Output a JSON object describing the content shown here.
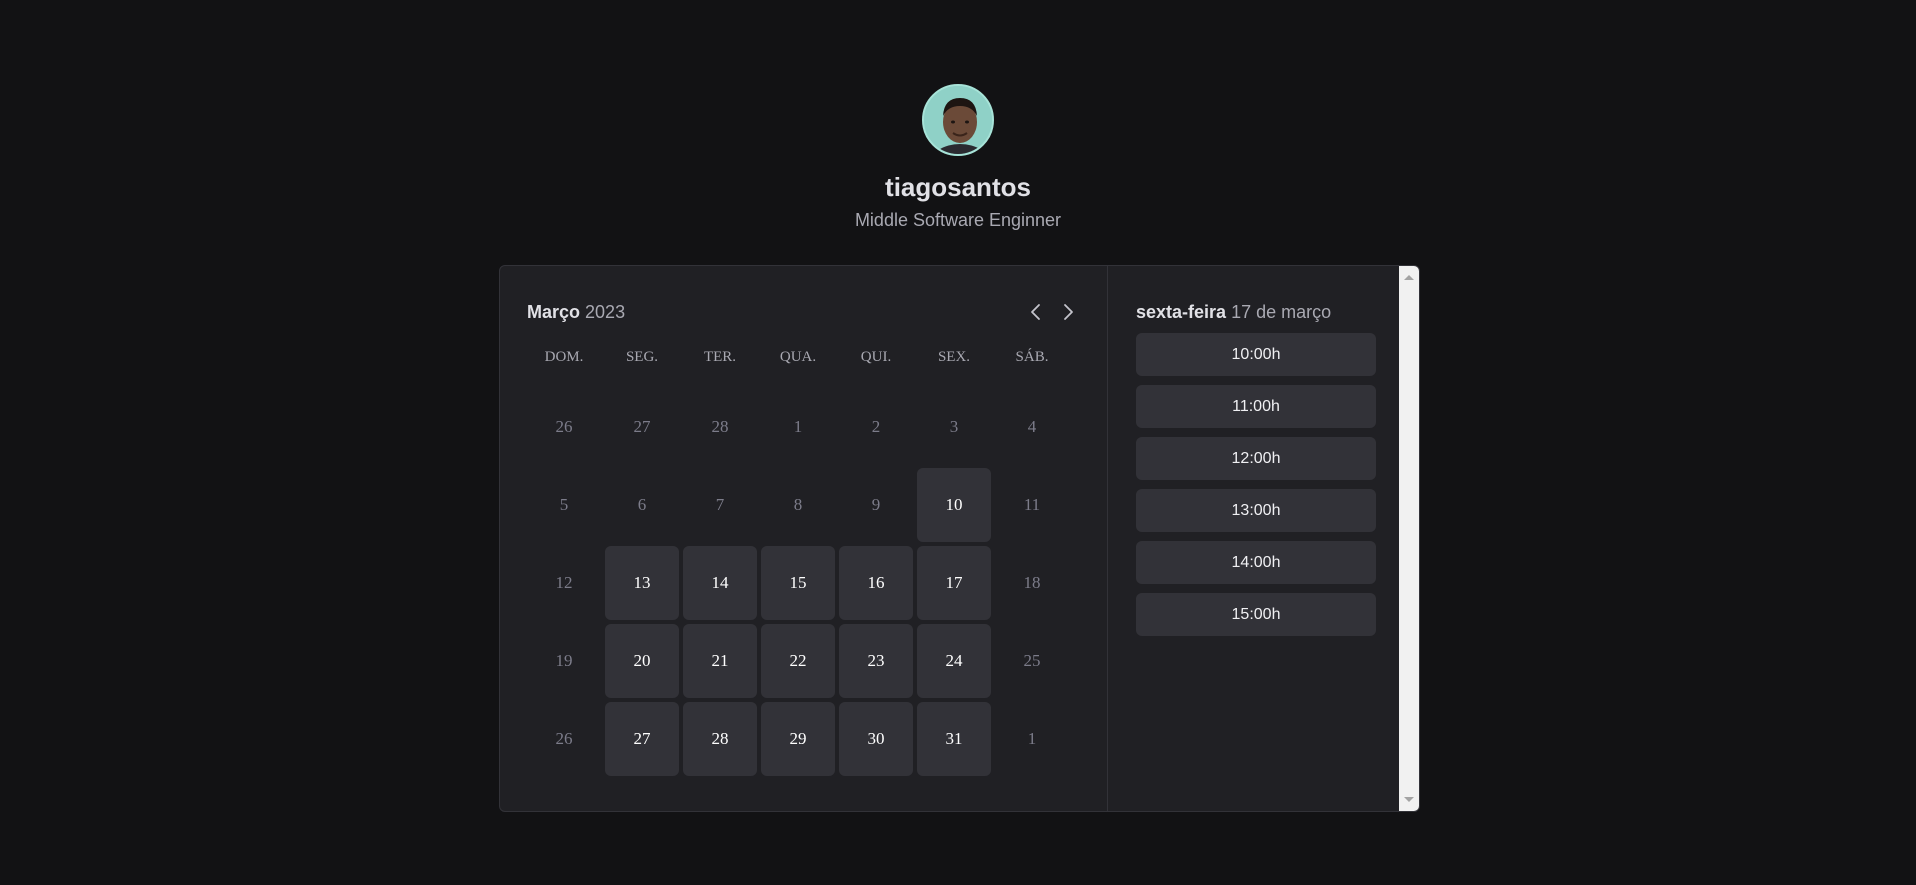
{
  "profile": {
    "username": "tiagosantos",
    "role": "Middle Software Enginner",
    "avatar_icon": "avatar-photo"
  },
  "calendar": {
    "month": "Março",
    "year": "2023",
    "prev_icon": "chevron-left-icon",
    "next_icon": "chevron-right-icon",
    "weekdays": [
      "DOM.",
      "SEG.",
      "TER.",
      "QUA.",
      "QUI.",
      "SEX.",
      "SÁB."
    ],
    "weeks": [
      [
        {
          "d": "26",
          "a": false
        },
        {
          "d": "27",
          "a": false
        },
        {
          "d": "28",
          "a": false
        },
        {
          "d": "1",
          "a": false
        },
        {
          "d": "2",
          "a": false
        },
        {
          "d": "3",
          "a": false
        },
        {
          "d": "4",
          "a": false
        }
      ],
      [
        {
          "d": "5",
          "a": false
        },
        {
          "d": "6",
          "a": false
        },
        {
          "d": "7",
          "a": false
        },
        {
          "d": "8",
          "a": false
        },
        {
          "d": "9",
          "a": false
        },
        {
          "d": "10",
          "a": true
        },
        {
          "d": "11",
          "a": false
        }
      ],
      [
        {
          "d": "12",
          "a": false
        },
        {
          "d": "13",
          "a": true
        },
        {
          "d": "14",
          "a": true
        },
        {
          "d": "15",
          "a": true
        },
        {
          "d": "16",
          "a": true
        },
        {
          "d": "17",
          "a": true
        },
        {
          "d": "18",
          "a": false
        }
      ],
      [
        {
          "d": "19",
          "a": false
        },
        {
          "d": "20",
          "a": true
        },
        {
          "d": "21",
          "a": true
        },
        {
          "d": "22",
          "a": true
        },
        {
          "d": "23",
          "a": true
        },
        {
          "d": "24",
          "a": true
        },
        {
          "d": "25",
          "a": false
        }
      ],
      [
        {
          "d": "26",
          "a": false
        },
        {
          "d": "27",
          "a": true
        },
        {
          "d": "28",
          "a": true
        },
        {
          "d": "29",
          "a": true
        },
        {
          "d": "30",
          "a": true
        },
        {
          "d": "31",
          "a": true
        },
        {
          "d": "1",
          "a": false
        }
      ]
    ]
  },
  "times": {
    "weekday": "sexta-feira",
    "date": "17 de março",
    "slots": [
      "10:00h",
      "11:00h",
      "12:00h",
      "13:00h",
      "14:00h",
      "15:00h"
    ]
  },
  "colors": {
    "background": "#121214",
    "card": "#202024",
    "available_day": "#323238",
    "text": "#e1e1e6"
  }
}
